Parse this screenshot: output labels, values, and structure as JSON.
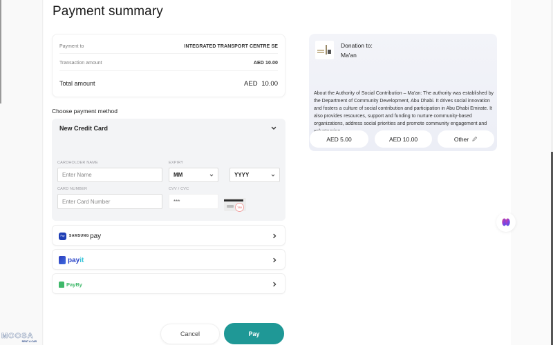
{
  "title": "Payment summary",
  "summary": {
    "payment_to_label": "Payment to",
    "payment_to_value": "INTEGRATED TRANSPORT CENTRE SE",
    "transaction_label": "Transaction amount",
    "transaction_value": "AED 10.00",
    "total_label": "Total amount",
    "total_value": "AED 10.00"
  },
  "payment_method": {
    "section_label": "Choose payment method",
    "credit_card": {
      "header": "New Credit Card",
      "cardholder_label": "CARDHOLDER NAME",
      "cardholder_placeholder": "Enter Name",
      "expiry_label": "EXPIRY",
      "month_value": "MM",
      "year_value": "YYYY",
      "card_number_label": "CARD NUMBER",
      "card_number_placeholder": "Enter Card Number",
      "cvv_label": "CVV / CVC",
      "cvv_placeholder": "***",
      "cvv_hint_badge": "780"
    },
    "options": [
      {
        "name": "samsung-pay",
        "brand_small": "SAMSUNG",
        "brand_big": "pay",
        "icon_text": "Pay"
      },
      {
        "name": "payit",
        "brand_main": "pay",
        "brand_accent": "it"
      },
      {
        "name": "payby",
        "brand": "PayBy"
      }
    ]
  },
  "actions": {
    "cancel_label": "Cancel",
    "pay_label": "Pay"
  },
  "donation": {
    "title": "Donation to:",
    "name": "Ma'an",
    "description": "About the Authority of Social Contribution – Ma'an: The authority was established by the Department of Community Development, Abu Dhabi. It drives social innovation and fosters a culture of social contribution and participation in Abu Dhabi Emirate. It also provides resources, support and funding to nurture community-based organizations, address social priorities and promote community engagement and volunteering.",
    "amounts": [
      "AED 5.00",
      "AED 10.00"
    ],
    "other_label": "Other"
  },
  "watermark": {
    "brand": "MOOSA",
    "sub": "RENT A CAR"
  },
  "colors": {
    "primary": "#1f9896",
    "samsung_blue": "#1f3fb5",
    "payit_blue": "#2b46c9",
    "payby_green": "#3fb86a"
  }
}
